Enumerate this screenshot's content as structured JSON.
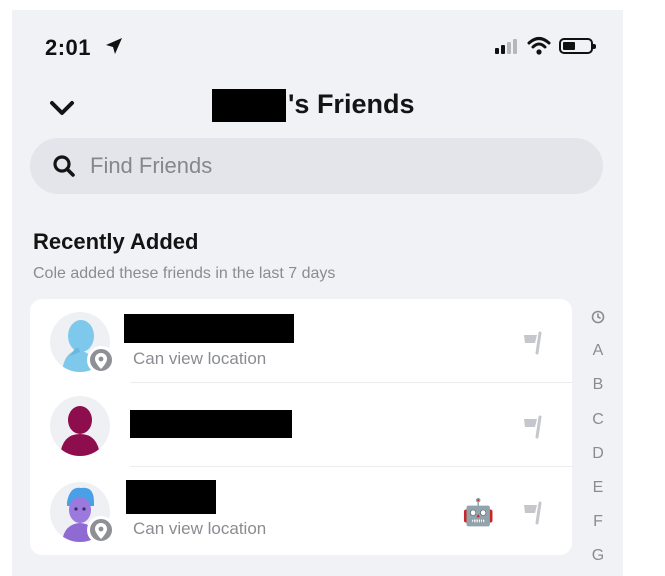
{
  "status_bar": {
    "time": "2:01",
    "icons": [
      "location-arrow-icon",
      "cellular-signal-icon",
      "wifi-icon",
      "battery-icon"
    ]
  },
  "header": {
    "back_icon": "chevron-down-icon",
    "title_suffix": "'s Friends"
  },
  "search": {
    "icon": "search-icon",
    "placeholder": "Find Friends",
    "value": ""
  },
  "section": {
    "title": "Recently Added",
    "subtitle": "Cole added these friends in the last 7 days"
  },
  "friends": [
    {
      "subtitle": "Can view location",
      "icon": "location-pin-icon",
      "action_icon": "flag-icon"
    },
    {
      "subtitle": "",
      "action_icon": "flag-icon"
    },
    {
      "subtitle": "Can view location",
      "icon": "location-pin-icon",
      "badge": "🤖",
      "action_icon": "flag-icon"
    }
  ],
  "alpha_index": [
    "A",
    "B",
    "C",
    "D",
    "E",
    "F",
    "G"
  ],
  "colors": {
    "background": "#f1f2f6",
    "card": "#ffffff",
    "search_bg": "#e4e5ea",
    "muted_text": "#8a8c91",
    "avatar_blue": "#7ec8ec",
    "avatar_magenta": "#8e0d4d",
    "avatar_purple": "#8f6ad3"
  }
}
